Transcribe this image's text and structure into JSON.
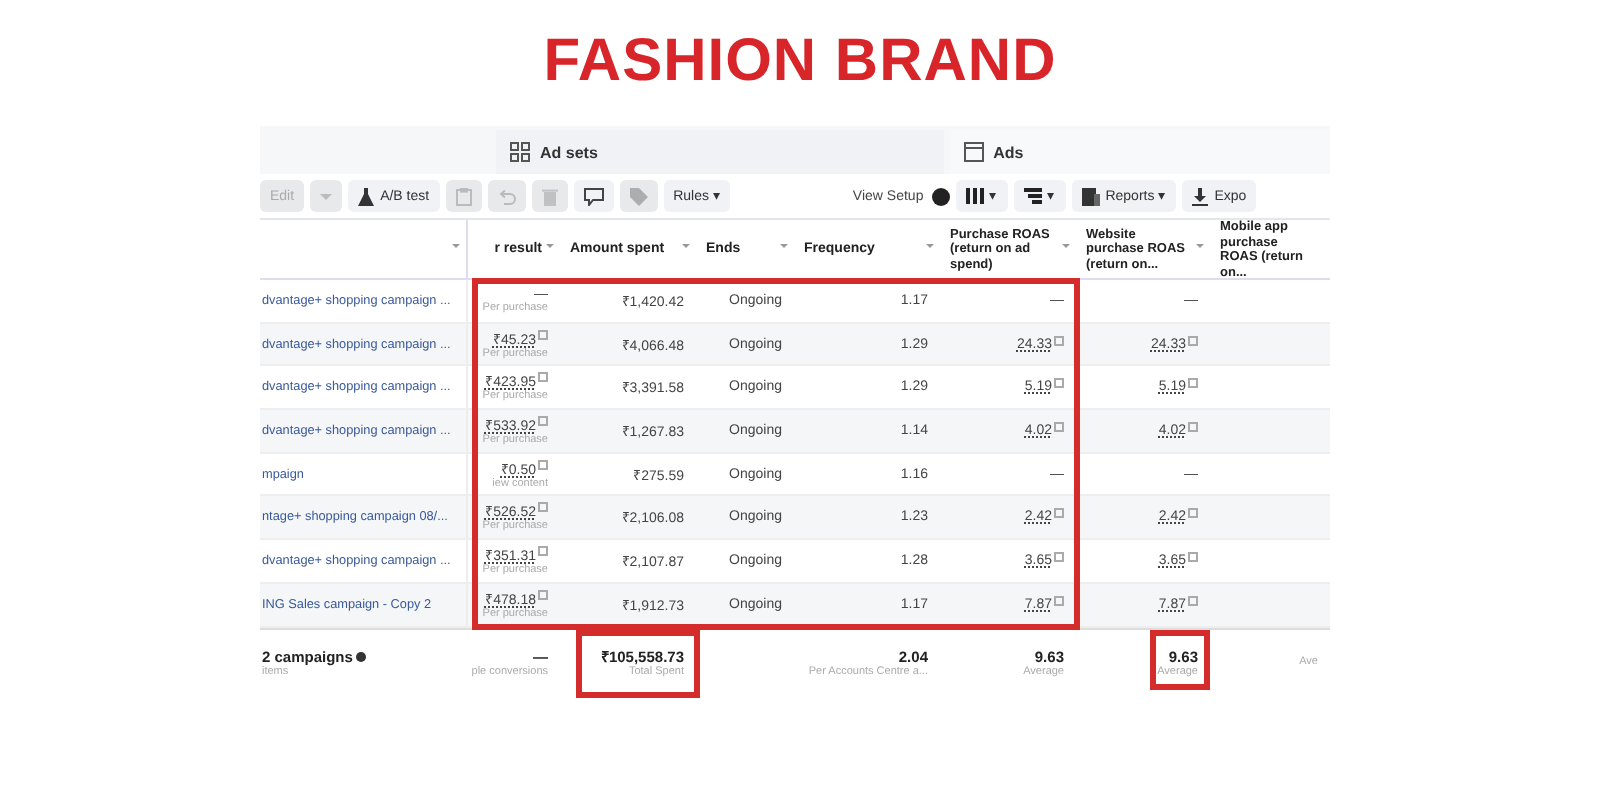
{
  "title": "FASHION BRAND",
  "tabs": [
    {
      "label": "Ad sets"
    },
    {
      "label": "Ads"
    }
  ],
  "toolbar": [
    {
      "kind": "text",
      "label": "Edit",
      "disabled": true
    },
    {
      "kind": "caret",
      "disabled": true
    },
    {
      "kind": "flask",
      "label": "A/B test",
      "disabled": false
    },
    {
      "kind": "clipboard",
      "disabled": true
    },
    {
      "kind": "undo",
      "disabled": true
    },
    {
      "kind": "trash",
      "disabled": true
    },
    {
      "kind": "comment",
      "disabled": false
    },
    {
      "kind": "tag",
      "disabled": true
    },
    {
      "kind": "text",
      "label": "Rules ▾",
      "disabled": false
    },
    {
      "kind": "toggle",
      "label": "View Setup",
      "on": false
    },
    {
      "kind": "columns",
      "label": "▾",
      "disabled": false
    },
    {
      "kind": "breakdown",
      "label": "▾",
      "disabled": false
    },
    {
      "kind": "reports",
      "label": "Reports ▾",
      "disabled": false
    },
    {
      "kind": "download",
      "label": "Expo",
      "disabled": false
    }
  ],
  "table": {
    "columns": [
      {
        "kind": "blank"
      },
      {
        "kind": "label",
        "label": "r result"
      },
      {
        "kind": "label",
        "label": "Amount spent"
      },
      {
        "kind": "label",
        "label": "Ends"
      },
      {
        "kind": "label",
        "label": "Frequency"
      },
      {
        "kind": "label",
        "label": "Purchase ROAS (return on ad spend)"
      },
      {
        "kind": "label",
        "label": "Website purchase ROAS (return on..."
      },
      {
        "kind": "label",
        "label": "Mobile app purchase ROAS (return on..."
      }
    ],
    "rows": [
      {
        "name": "dvantage+ shopping campaign ...",
        "result": "—",
        "result_sub": "Per purchase",
        "amount": "₹1,420.42",
        "ends": "Ongoing",
        "frequency": "1.17",
        "purchase_roas": "—",
        "website_roas": "—"
      },
      {
        "name": "dvantage+ shopping campaign ...",
        "result": "₹45.23",
        "result_sub": "Per purchase",
        "amount": "₹4,066.48",
        "ends": "Ongoing",
        "frequency": "1.29",
        "purchase_roas": "24.33",
        "website_roas": "24.33"
      },
      {
        "name": "dvantage+ shopping campaign ...",
        "result": "₹423.95",
        "result_sub": "Per purchase",
        "amount": "₹3,391.58",
        "ends": "Ongoing",
        "frequency": "1.29",
        "purchase_roas": "5.19",
        "website_roas": "5.19"
      },
      {
        "name": "dvantage+ shopping campaign ...",
        "result": "₹533.92",
        "result_sub": "Per purchase",
        "amount": "₹1,267.83",
        "ends": "Ongoing",
        "frequency": "1.14",
        "purchase_roas": "4.02",
        "website_roas": "4.02"
      },
      {
        "name": "mpaign",
        "result": "₹0.50",
        "result_sub": "iew content",
        "amount": "₹275.59",
        "ends": "Ongoing",
        "frequency": "1.16",
        "purchase_roas": "—",
        "website_roas": "—"
      },
      {
        "name": "ntage+ shopping campaign 08/...",
        "result": "₹526.52",
        "result_sub": "Per purchase",
        "amount": "₹2,106.08",
        "ends": "Ongoing",
        "frequency": "1.23",
        "purchase_roas": "2.42",
        "website_roas": "2.42"
      },
      {
        "name": "dvantage+ shopping campaign ...",
        "result": "₹351.31",
        "result_sub": "Per purchase",
        "amount": "₹2,107.87",
        "ends": "Ongoing",
        "frequency": "1.28",
        "purchase_roas": "3.65",
        "website_roas": "3.65"
      },
      {
        "name": "ING Sales campaign - Copy 2",
        "result": "₹478.18",
        "result_sub": "Per purchase",
        "amount": "₹1,912.73",
        "ends": "Ongoing",
        "frequency": "1.17",
        "purchase_roas": "7.87",
        "website_roas": "7.87"
      }
    ],
    "total": [
      {
        "kind": "value",
        "value": "2 campaigns",
        "sub": "items",
        "info": true
      },
      {
        "kind": "value",
        "value": "—",
        "sub": "ple conversions",
        "info": false
      },
      {
        "kind": "value",
        "value": "₹105,558.73",
        "sub": "Total Spent",
        "info": false
      },
      {
        "kind": "empty"
      },
      {
        "kind": "value",
        "value": "2.04",
        "sub": "Per Accounts Centre a...",
        "info": false
      },
      {
        "kind": "value",
        "value": "9.63",
        "sub": "Average",
        "info": false
      },
      {
        "kind": "value",
        "value": "9.63",
        "sub": "Average",
        "info": false
      },
      {
        "kind": "caption",
        "sub": "Ave"
      }
    ]
  },
  "highlights": [
    {
      "kind": "rows"
    },
    {
      "kind": "total-amount"
    },
    {
      "kind": "total-website"
    }
  ]
}
